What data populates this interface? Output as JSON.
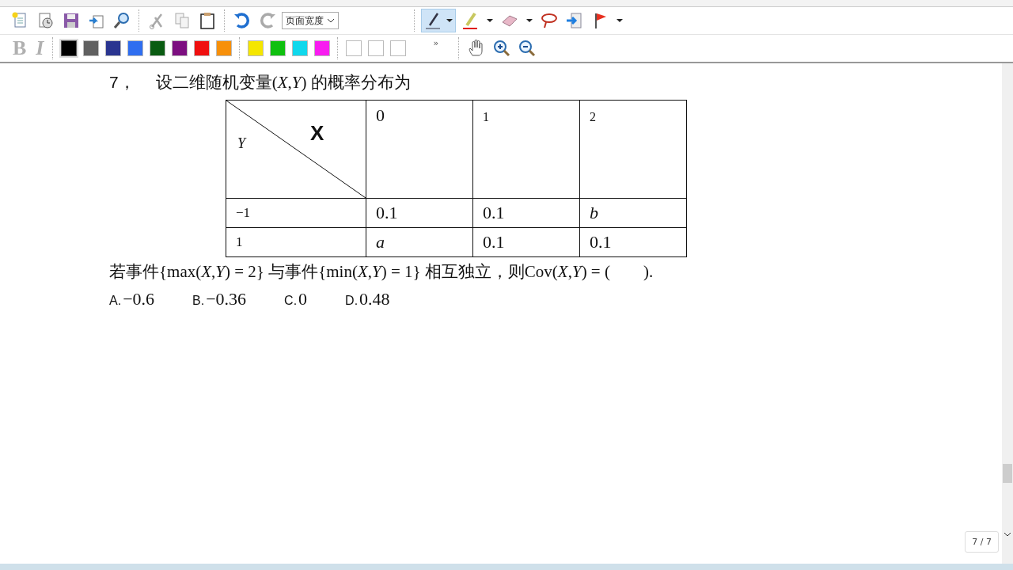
{
  "toolbar": {
    "zoom_select": {
      "value": "页面宽度"
    },
    "pen_tool": {
      "selected": true
    },
    "swatches": [
      {
        "color": "#000000",
        "selected": true
      },
      {
        "color": "#606060",
        "selected": false
      },
      {
        "color": "#2a3590",
        "selected": false
      },
      {
        "color": "#2f6ef0",
        "selected": false
      },
      {
        "color": "#0a5c12",
        "selected": false
      },
      {
        "color": "#7c0f80",
        "selected": false
      },
      {
        "color": "#f01010",
        "selected": false
      },
      {
        "color": "#f7900a",
        "selected": false
      },
      {
        "color": "#f5e600",
        "selected": false
      },
      {
        "color": "#10c010",
        "selected": false
      },
      {
        "color": "#10d8ec",
        "selected": false
      },
      {
        "color": "#f81cf0",
        "selected": false
      }
    ],
    "overflow": "»",
    "format_buttons": [
      "B",
      "I"
    ]
  },
  "question": {
    "number": "7，",
    "stem": "设二维随机变量(*X*,*Y*) 的概率分布为",
    "table": {
      "col_label": "X",
      "row_label": "Y",
      "columns": [
        "0",
        "1",
        "2"
      ],
      "rows": [
        {
          "label": "−1",
          "cells": [
            {
              "text": "0.1",
              "kind": "number"
            },
            {
              "text": "0.1",
              "kind": "number"
            },
            {
              "text": "b",
              "kind": "variable"
            }
          ]
        },
        {
          "label": "1",
          "cells": [
            {
              "text": "a",
              "kind": "variable"
            },
            {
              "text": "0.1",
              "kind": "number"
            },
            {
              "text": "0.1",
              "kind": "number"
            }
          ]
        }
      ]
    },
    "condition": "若事件{max(*X*,*Y*) = 2} 与事件{min(*X*,*Y*) = 1} 相互独立，则Cov(*X*,*Y*) = (　　).",
    "options": [
      {
        "letter": "A.",
        "value": "−0.6"
      },
      {
        "letter": "B.",
        "value": "−0.36"
      },
      {
        "letter": "C.",
        "value": "0"
      },
      {
        "letter": "D.",
        "value": "0.48"
      }
    ]
  },
  "page_indicator": "7 / 7"
}
